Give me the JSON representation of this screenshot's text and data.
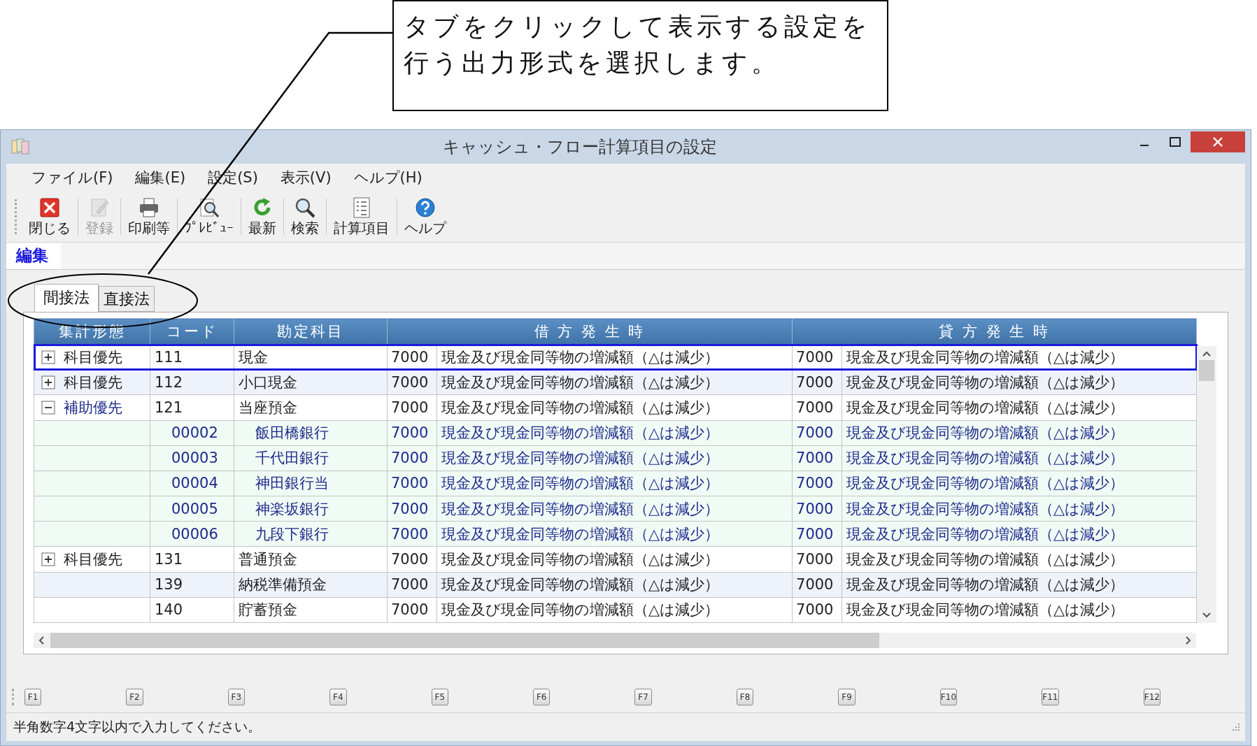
{
  "callout": {
    "text": "タブをクリックして表示する設定を行う出力形式を選択します。"
  },
  "window": {
    "title": "キャッシュ・フロー計算項目の設定"
  },
  "menu": [
    "ファイル(F)",
    "編集(E)",
    "設定(S)",
    "表示(V)",
    "ヘルプ(H)"
  ],
  "toolbar": [
    {
      "kind": "close",
      "label": "閉じる",
      "disabled": false
    },
    {
      "kind": "register",
      "label": "登録",
      "disabled": true
    },
    {
      "kind": "print",
      "label": "印刷等",
      "disabled": false
    },
    {
      "kind": "preview",
      "label": "ﾌﾟﾚﾋﾞｭｰ",
      "disabled": false
    },
    {
      "kind": "refresh",
      "label": "最新",
      "disabled": false
    },
    {
      "kind": "search",
      "label": "検索",
      "disabled": false
    },
    {
      "kind": "items",
      "label": "計算項目",
      "disabled": false
    },
    {
      "kind": "help",
      "label": "ヘルプ",
      "disabled": false
    }
  ],
  "mode_tab": {
    "label": "編集"
  },
  "tabs": [
    {
      "label": "間接法",
      "selected": true
    },
    {
      "label": "直接法",
      "selected": false
    }
  ],
  "table": {
    "columns": [
      "集計形態",
      "コード",
      "勘定科目",
      "借 方 発 生 時",
      "貸 方 発 生 時"
    ],
    "rows": [
      {
        "kind": "group",
        "expanded": false,
        "selected": true,
        "type": "科目優先",
        "code": "111",
        "name": "現金",
        "debit_code": "7000",
        "debit_name": "現金及び現金同等物の増減額（△は減少）",
        "credit_code": "7000",
        "credit_name": "現金及び現金同等物の増減額（△は減少）"
      },
      {
        "kind": "group",
        "expanded": false,
        "selected": false,
        "type": "科目優先",
        "code": "112",
        "name": "小口現金",
        "debit_code": "7000",
        "debit_name": "現金及び現金同等物の増減額（△は減少）",
        "credit_code": "7000",
        "credit_name": "現金及び現金同等物の増減額（△は減少）"
      },
      {
        "kind": "group",
        "expanded": true,
        "selected": false,
        "type": "補助優先",
        "code": "121",
        "name": "当座預金",
        "debit_code": "7000",
        "debit_name": "現金及び現金同等物の増減額（△は減少）",
        "credit_code": "7000",
        "credit_name": "現金及び現金同等物の増減額（△は減少）"
      },
      {
        "kind": "child",
        "selected": false,
        "code": "00002",
        "name": "飯田橋銀行",
        "debit_code": "7000",
        "debit_name": "現金及び現金同等物の増減額（△は減少）",
        "credit_code": "7000",
        "credit_name": "現金及び現金同等物の増減額（△は減少）"
      },
      {
        "kind": "child",
        "selected": false,
        "code": "00003",
        "name": "千代田銀行",
        "debit_code": "7000",
        "debit_name": "現金及び現金同等物の増減額（△は減少）",
        "credit_code": "7000",
        "credit_name": "現金及び現金同等物の増減額（△は減少）"
      },
      {
        "kind": "child",
        "selected": false,
        "code": "00004",
        "name": "神田銀行当",
        "debit_code": "7000",
        "debit_name": "現金及び現金同等物の増減額（△は減少）",
        "credit_code": "7000",
        "credit_name": "現金及び現金同等物の増減額（△は減少）"
      },
      {
        "kind": "child",
        "selected": false,
        "code": "00005",
        "name": "神楽坂銀行",
        "debit_code": "7000",
        "debit_name": "現金及び現金同等物の増減額（△は減少）",
        "credit_code": "7000",
        "credit_name": "現金及び現金同等物の増減額（△は減少）"
      },
      {
        "kind": "child",
        "selected": false,
        "code": "00006",
        "name": "九段下銀行",
        "debit_code": "7000",
        "debit_name": "現金及び現金同等物の増減額（△は減少）",
        "credit_code": "7000",
        "credit_name": "現金及び現金同等物の増減額（△は減少）"
      },
      {
        "kind": "group",
        "expanded": false,
        "selected": false,
        "type": "科目優先",
        "code": "131",
        "name": "普通預金",
        "debit_code": "7000",
        "debit_name": "現金及び現金同等物の増減額（△は減少）",
        "credit_code": "7000",
        "credit_name": "現金及び現金同等物の増減額（△は減少）"
      },
      {
        "kind": "plain",
        "selected": false,
        "code": "139",
        "name": "納税準備預金",
        "debit_code": "7000",
        "debit_name": "現金及び現金同等物の増減額（△は減少）",
        "credit_code": "7000",
        "credit_name": "現金及び現金同等物の増減額（△は減少）"
      },
      {
        "kind": "plain",
        "selected": false,
        "code": "140",
        "name": "貯蓄預金",
        "debit_code": "7000",
        "debit_name": "現金及び現金同等物の増減額（△は減少）",
        "credit_code": "7000",
        "credit_name": "現金及び現金同等物の増減額（△は減少）"
      }
    ]
  },
  "function_keys": [
    "F1",
    "F2",
    "F3",
    "F4",
    "F5",
    "F6",
    "F7",
    "F8",
    "F9",
    "F10",
    "F11",
    "F12"
  ],
  "status_bar": {
    "text": "半角数字4文字以内で入力してください。"
  }
}
